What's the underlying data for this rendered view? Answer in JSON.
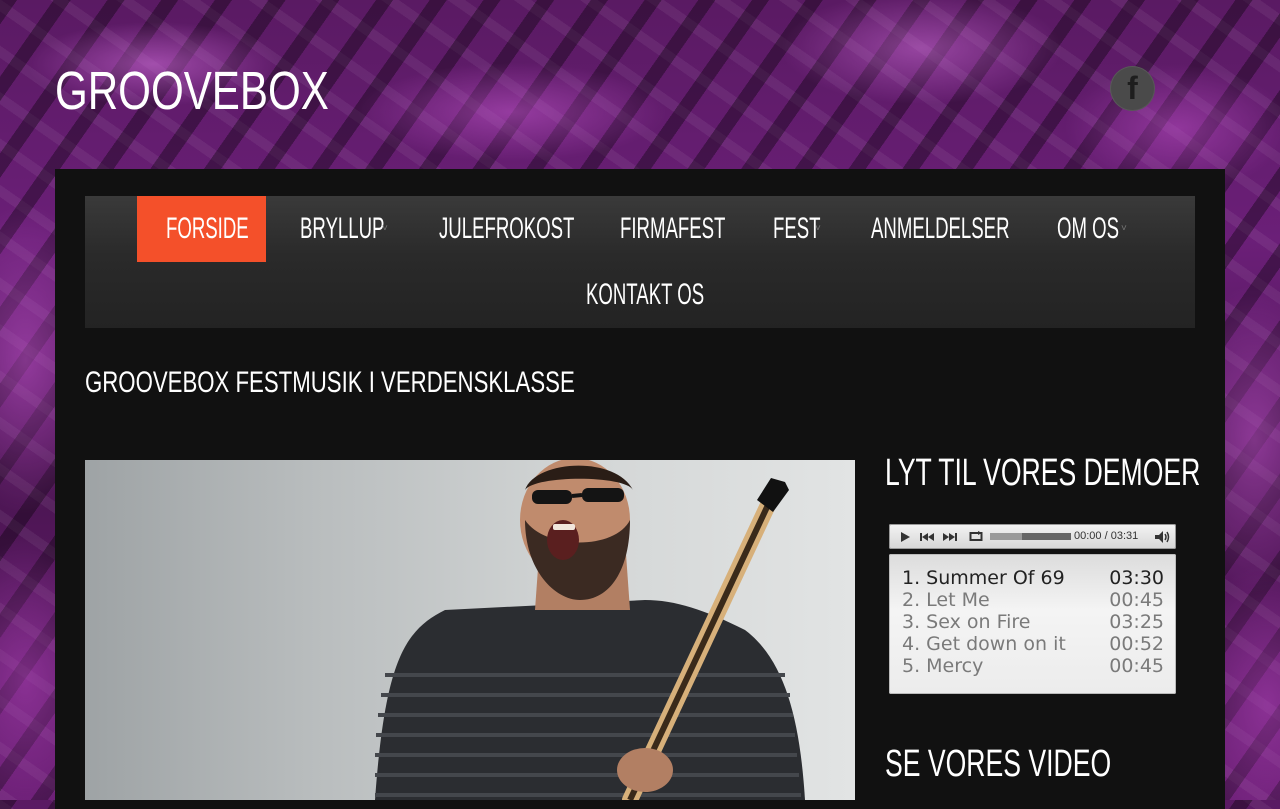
{
  "site": {
    "title": "GROOVEBOX",
    "social": {
      "facebook_icon": "facebook-icon",
      "facebook_glyph": "f"
    }
  },
  "nav": {
    "items": [
      {
        "label": "FORSIDE",
        "active": true,
        "has_submenu": false
      },
      {
        "label": "BRYLLUP",
        "active": false,
        "has_submenu": true
      },
      {
        "label": "JULEFROKOST",
        "active": false,
        "has_submenu": false
      },
      {
        "label": "FIRMAFEST",
        "active": false,
        "has_submenu": false
      },
      {
        "label": "FEST",
        "active": false,
        "has_submenu": true
      },
      {
        "label": "ANMELDELSER",
        "active": false,
        "has_submenu": false
      },
      {
        "label": "OM OS",
        "active": false,
        "has_submenu": true
      },
      {
        "label": "KONTAKT OS",
        "active": false,
        "has_submenu": false
      }
    ],
    "submenu_caret": "˅"
  },
  "main": {
    "heading": "GROOVEBOX FESTMUSIK I VERDENSKLASSE",
    "hero_image": "guitarist-laughing-photo"
  },
  "sidebar": {
    "demo_heading": "LYT TIL VORES DEMOER",
    "player": {
      "current_time": "00:00",
      "separator": "/",
      "total_time": "03:31",
      "loaded_fraction": 0.4,
      "icons": [
        "play-icon",
        "previous-icon",
        "next-icon",
        "repeat-icon",
        "volume-icon"
      ]
    },
    "playlist": [
      {
        "name": "1. Summer Of 69",
        "duration": "03:30",
        "current": true
      },
      {
        "name": "2. Let Me",
        "duration": "00:45",
        "current": false
      },
      {
        "name": "3. Sex on Fire",
        "duration": "03:25",
        "current": false
      },
      {
        "name": "4. Get down on it",
        "duration": "00:52",
        "current": false
      },
      {
        "name": "5. Mercy",
        "duration": "00:45",
        "current": false
      }
    ],
    "video_heading": "SE VORES VIDEO"
  },
  "colors": {
    "accent": "#f4502a",
    "background_purple": "#6b1f78",
    "panel": "#111111"
  }
}
